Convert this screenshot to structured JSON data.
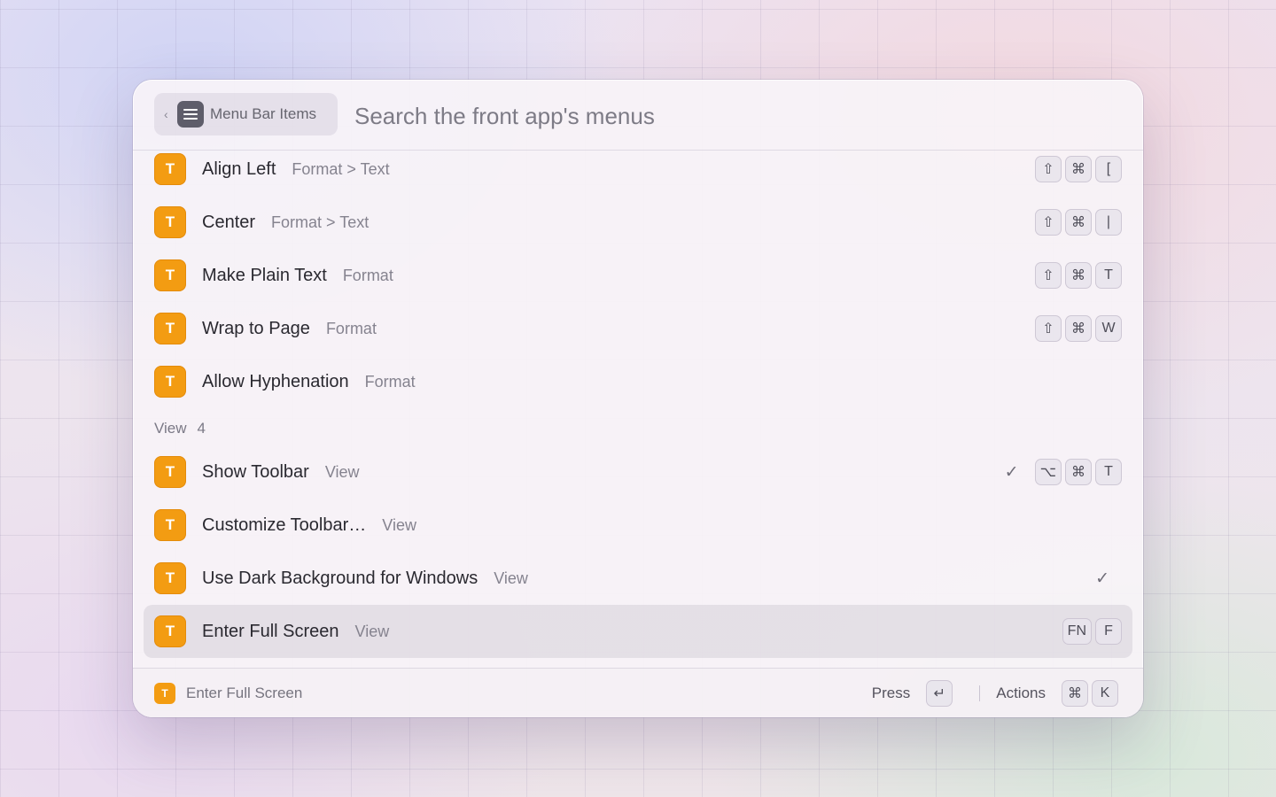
{
  "header": {
    "back_label": "Menu Bar Items",
    "search_placeholder": "Search the front app's menus"
  },
  "app_icon_letter": "T",
  "rows_top": [
    {
      "title": "Align Left",
      "subtitle": "Format > Text",
      "keys": [
        "⇧",
        "⌘",
        "["
      ],
      "checked": false
    },
    {
      "title": "Center",
      "subtitle": "Format > Text",
      "keys": [
        "⇧",
        "⌘",
        "|"
      ],
      "checked": false
    },
    {
      "title": "Make Plain Text",
      "subtitle": "Format",
      "keys": [
        "⇧",
        "⌘",
        "T"
      ],
      "checked": false
    },
    {
      "title": "Wrap to Page",
      "subtitle": "Format",
      "keys": [
        "⇧",
        "⌘",
        "W"
      ],
      "checked": false
    },
    {
      "title": "Allow Hyphenation",
      "subtitle": "Format",
      "keys": [],
      "checked": false
    }
  ],
  "section": {
    "name": "View",
    "count": "4"
  },
  "rows_view": [
    {
      "title": "Show Toolbar",
      "subtitle": "View",
      "keys": [
        "⌥",
        "⌘",
        "T"
      ],
      "checked": true
    },
    {
      "title": "Customize Toolbar…",
      "subtitle": "View",
      "keys": [],
      "checked": false
    },
    {
      "title": "Use Dark Background for Windows",
      "subtitle": "View",
      "keys": [],
      "checked": true
    },
    {
      "title": "Enter Full Screen",
      "subtitle": "View",
      "keys": [
        "FN",
        "F"
      ],
      "checked": false,
      "selected": true
    }
  ],
  "check_glyph": "✓",
  "footer": {
    "title": "Enter Full Screen",
    "press_label": "Press",
    "press_key": "↵",
    "actions_label": "Actions",
    "actions_keys": [
      "⌘",
      "K"
    ]
  },
  "colors": {
    "accent": "#f39c12"
  }
}
